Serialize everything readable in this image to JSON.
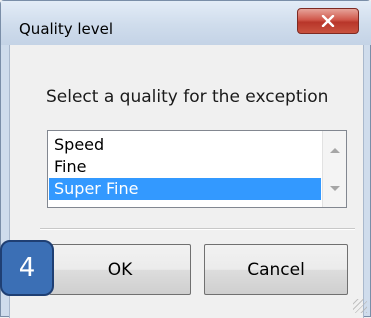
{
  "window": {
    "title": "Quality level",
    "close_glyph": "✕"
  },
  "dialog": {
    "prompt": "Select a quality for the exception",
    "list": {
      "items": [
        "Speed",
        "Fine",
        "Super Fine"
      ],
      "selected_index": 2
    },
    "buttons": {
      "ok_label": "OK",
      "cancel_label": "Cancel"
    }
  },
  "annotation": {
    "step_number": "4"
  },
  "colors": {
    "selection": "#3399ff",
    "close_button": "#c9503f",
    "badge": "#3b6fb5"
  }
}
